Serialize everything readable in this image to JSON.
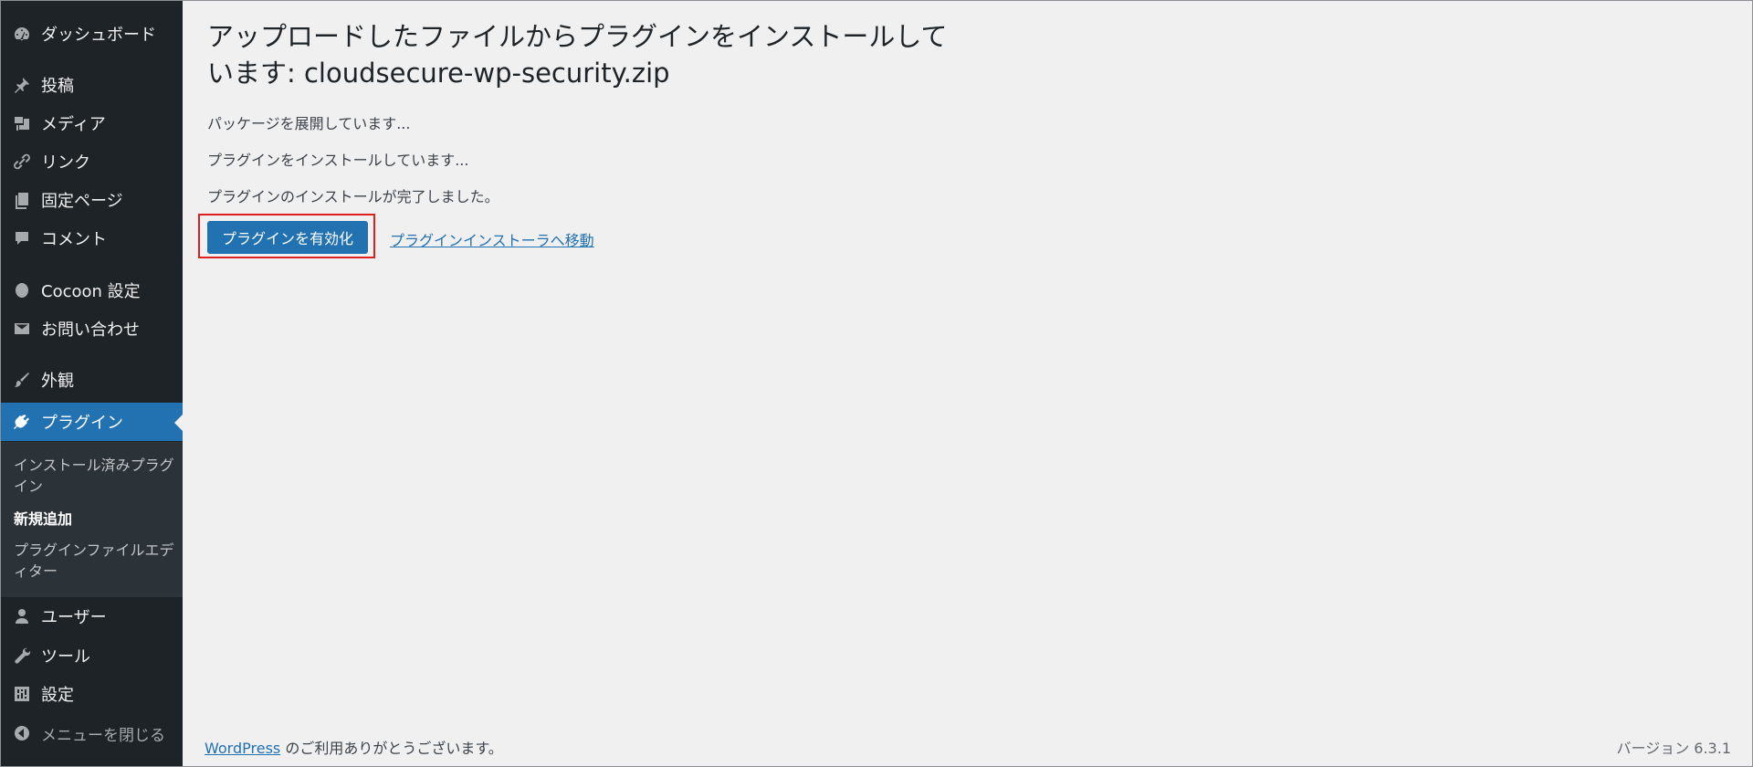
{
  "sidebar": {
    "items": [
      {
        "key": "dashboard",
        "label": "ダッシュボード",
        "icon": "dashboard-icon"
      },
      {
        "key": "posts",
        "label": "投稿",
        "icon": "pin-icon"
      },
      {
        "key": "media",
        "label": "メディア",
        "icon": "media-icon"
      },
      {
        "key": "links",
        "label": "リンク",
        "icon": "link-icon"
      },
      {
        "key": "pages",
        "label": "固定ページ",
        "icon": "pages-icon"
      },
      {
        "key": "comments",
        "label": "コメント",
        "icon": "comment-icon"
      },
      {
        "key": "cocoon",
        "label": "Cocoon 設定",
        "icon": "cocoon-icon"
      },
      {
        "key": "contact",
        "label": "お問い合わせ",
        "icon": "mail-icon"
      },
      {
        "key": "appearance",
        "label": "外観",
        "icon": "brush-icon"
      },
      {
        "key": "plugins",
        "label": "プラグイン",
        "icon": "plugin-icon"
      },
      {
        "key": "users",
        "label": "ユーザー",
        "icon": "user-icon"
      },
      {
        "key": "tools",
        "label": "ツール",
        "icon": "wrench-icon"
      },
      {
        "key": "settings",
        "label": "設定",
        "icon": "settings-icon"
      },
      {
        "key": "collapse",
        "label": "メニューを閉じる",
        "icon": "collapse-icon"
      }
    ],
    "submenu": [
      {
        "label": "インストール済みプラグイン"
      },
      {
        "label": "新規追加"
      },
      {
        "label": "プラグインファイルエディター"
      }
    ]
  },
  "main": {
    "title": "アップロードしたファイルからプラグインをインストールしています: cloudsecure-wp-security.zip",
    "messages": [
      "パッケージを展開しています...",
      "プラグインをインストールしています...",
      "プラグインのインストールが完了しました。"
    ],
    "activate_button": "プラグインを有効化",
    "installer_link": "プラグインインストーラへ移動"
  },
  "footer": {
    "wordpress_link": "WordPress",
    "thanks_text": " のご利用ありがとうございます。",
    "version": "バージョン 6.3.1"
  },
  "colors": {
    "sidebar_bg": "#1d2327",
    "accent": "#2271b1",
    "highlight": "#e02020"
  }
}
